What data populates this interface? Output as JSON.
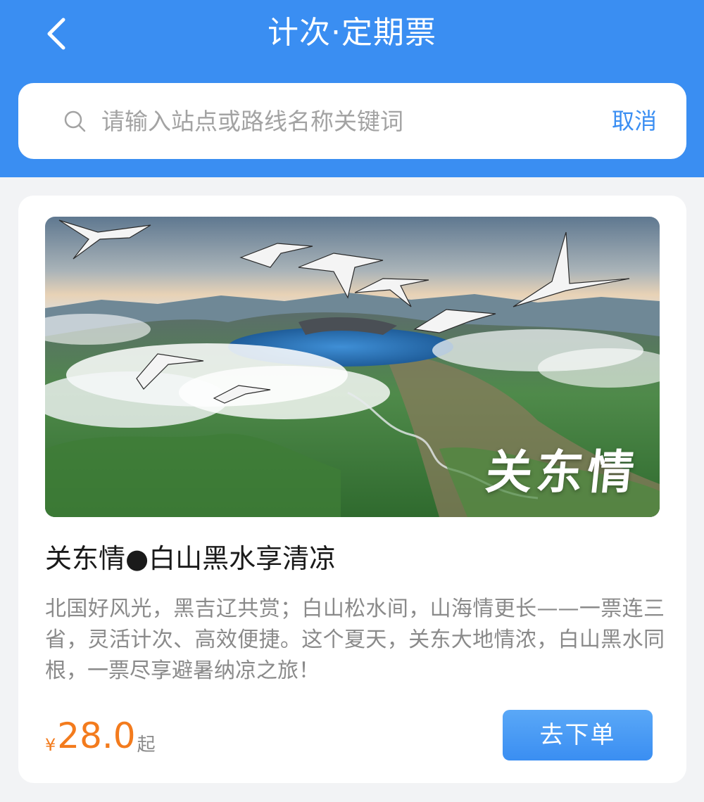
{
  "header": {
    "title": "计次·定期票",
    "back_icon": "chevron-left-icon",
    "background_color": "#3a8ef2"
  },
  "search": {
    "placeholder": "请输入站点或路线名称关键词",
    "value": "",
    "cancel_label": "取消",
    "icon": "search-icon"
  },
  "product": {
    "banner_text": "关东情",
    "title": "关东情●白山黑水享清凉",
    "description": "北国好风光，黑吉辽共赏；白山松水间，山海情更长——一票连三省，灵活计次、高效便捷。这个夏天，关东大地情浓，白山黑水同根，一票尽享避暑纳凉之旅！",
    "price_symbol": "¥",
    "price": "28.0",
    "price_suffix": "起",
    "order_label": "去下单",
    "price_color": "#f37b1d"
  }
}
